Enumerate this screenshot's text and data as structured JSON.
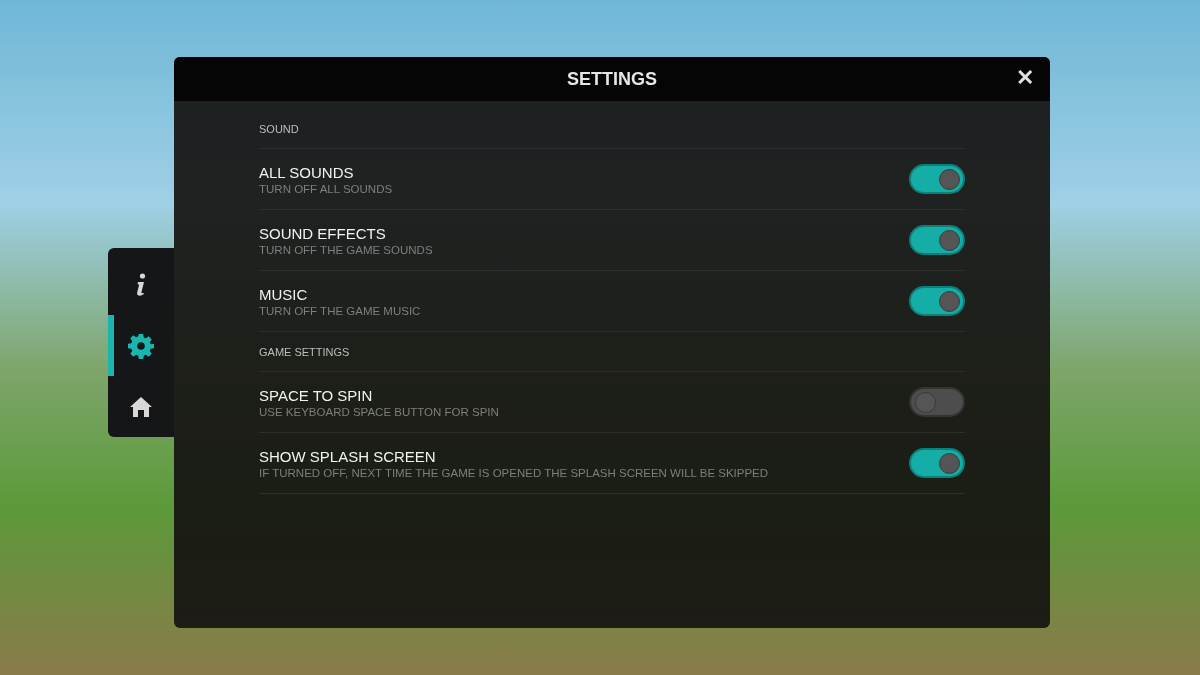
{
  "side_menu": {
    "items": [
      {
        "kind": "info",
        "selected": false
      },
      {
        "kind": "settings",
        "selected": true
      },
      {
        "kind": "home",
        "selected": false
      }
    ]
  },
  "dialog": {
    "title": "SETTINGS",
    "close": "✕"
  },
  "sections": [
    {
      "heading": "SOUND",
      "options": [
        {
          "label": "ALL SOUNDS",
          "description": "TURN OFF ALL SOUNDS",
          "on": true
        },
        {
          "label": "SOUND EFFECTS",
          "description": "TURN OFF THE GAME SOUNDS",
          "on": true
        },
        {
          "label": "MUSIC",
          "description": "TURN OFF THE GAME MUSIC",
          "on": true
        }
      ]
    },
    {
      "heading": "GAME SETTINGS",
      "options": [
        {
          "label": "SPACE TO SPIN",
          "description": "USE KEYBOARD SPACE BUTTON FOR SPIN",
          "on": false
        },
        {
          "label": "SHOW SPLASH SCREEN",
          "description": "IF TURNED OFF, NEXT TIME THE GAME IS OPENED THE SPLASH SCREEN WILL BE SKIPPED",
          "on": true
        }
      ]
    }
  ]
}
